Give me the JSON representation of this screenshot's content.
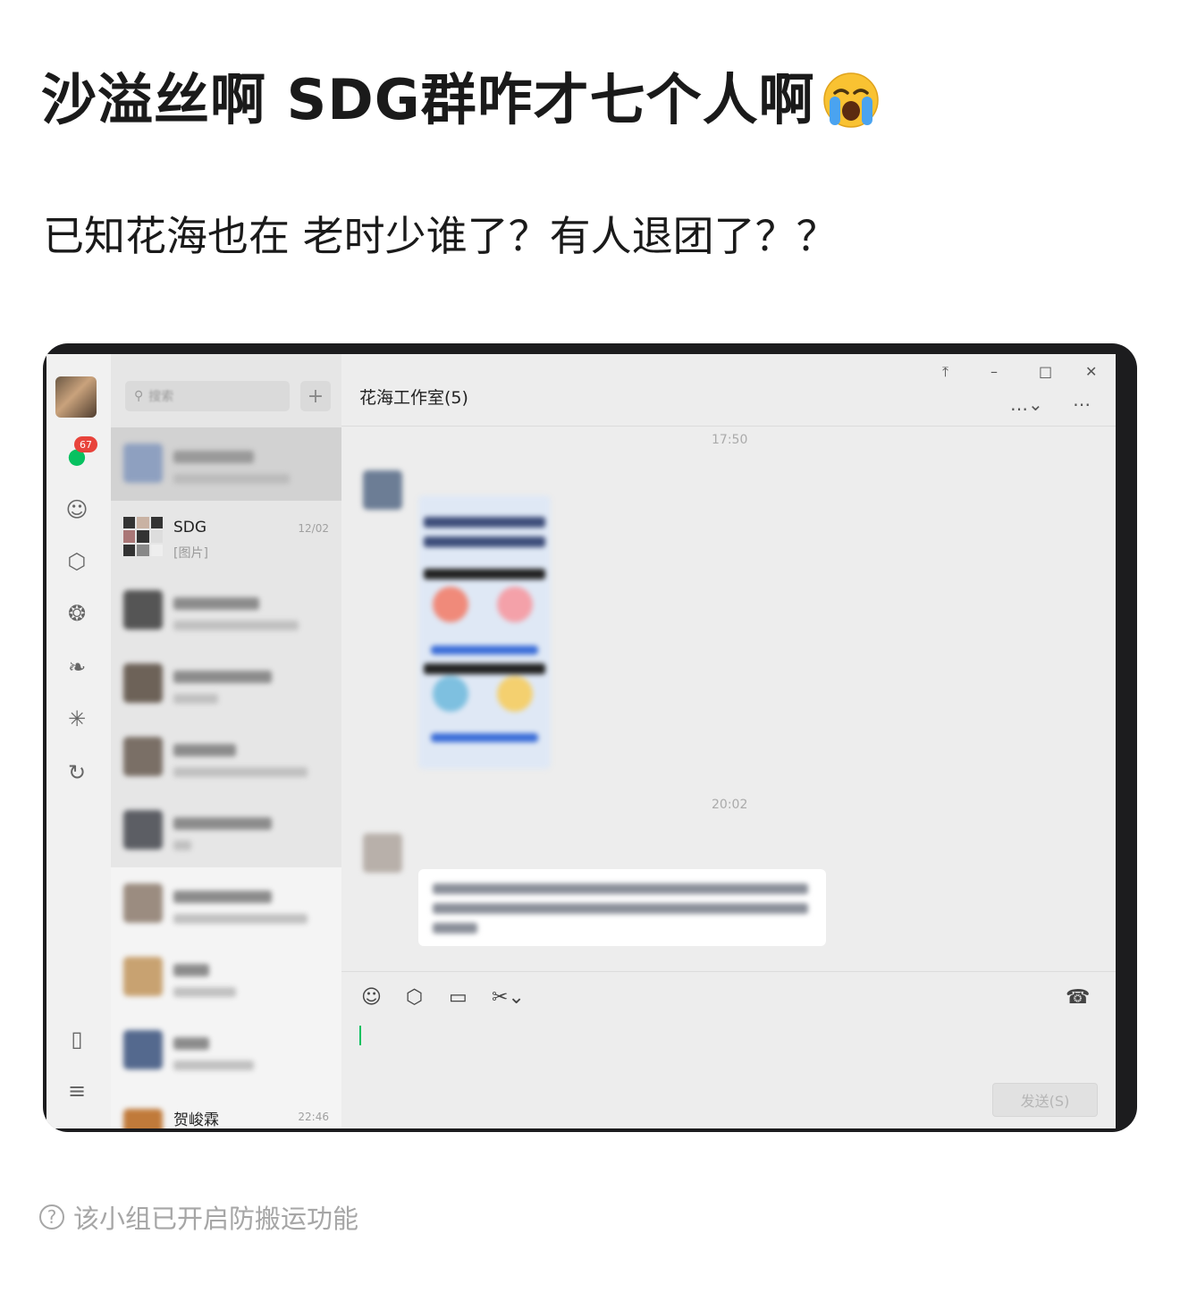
{
  "post": {
    "title": "沙溢丝啊 SDG群咋才七个人啊",
    "title_emoji": "loudly-crying-face",
    "body": "已知花海也在 老时少谁了？有人退团了？？"
  },
  "screenshot": {
    "rail": {
      "unread_badge": "67"
    },
    "search": {
      "placeholder": "搜索",
      "add": "+"
    },
    "chat_list": [
      {
        "name": "",
        "time": "",
        "preview": "",
        "blurred": true,
        "active": true
      },
      {
        "name": "SDG",
        "time": "12/02",
        "preview": "[图片]",
        "blurred": false
      },
      {
        "name": "",
        "time": "",
        "preview": "",
        "blurred": true
      },
      {
        "name": "",
        "time": "",
        "preview": "",
        "blurred": true
      },
      {
        "name": "",
        "time": "",
        "preview": "",
        "blurred": true
      },
      {
        "name": "",
        "time": "",
        "preview": "",
        "blurred": true
      },
      {
        "name": "",
        "time": "",
        "preview": "",
        "blurred": true
      },
      {
        "name": "",
        "time": "",
        "preview": "",
        "blurred": true
      },
      {
        "name": "",
        "time": "",
        "preview": "",
        "blurred": true
      },
      {
        "name": "贺峻霖",
        "time": "22:46",
        "preview": "",
        "blurred": false
      }
    ],
    "chat": {
      "title": "花海工作室(5)",
      "timestamps": [
        "17:50",
        "20:02"
      ],
      "send_button": "发送(S)"
    },
    "window_controls": [
      "pin-icon",
      "minimize-icon",
      "maximize-icon",
      "close-icon"
    ]
  },
  "notice": {
    "text": "该小组已开启防搬运功能",
    "icon": "question-circle-icon"
  },
  "colors": {
    "badge": "#e8433b",
    "caret": "#07c160",
    "frame": "#1c1c1e"
  }
}
